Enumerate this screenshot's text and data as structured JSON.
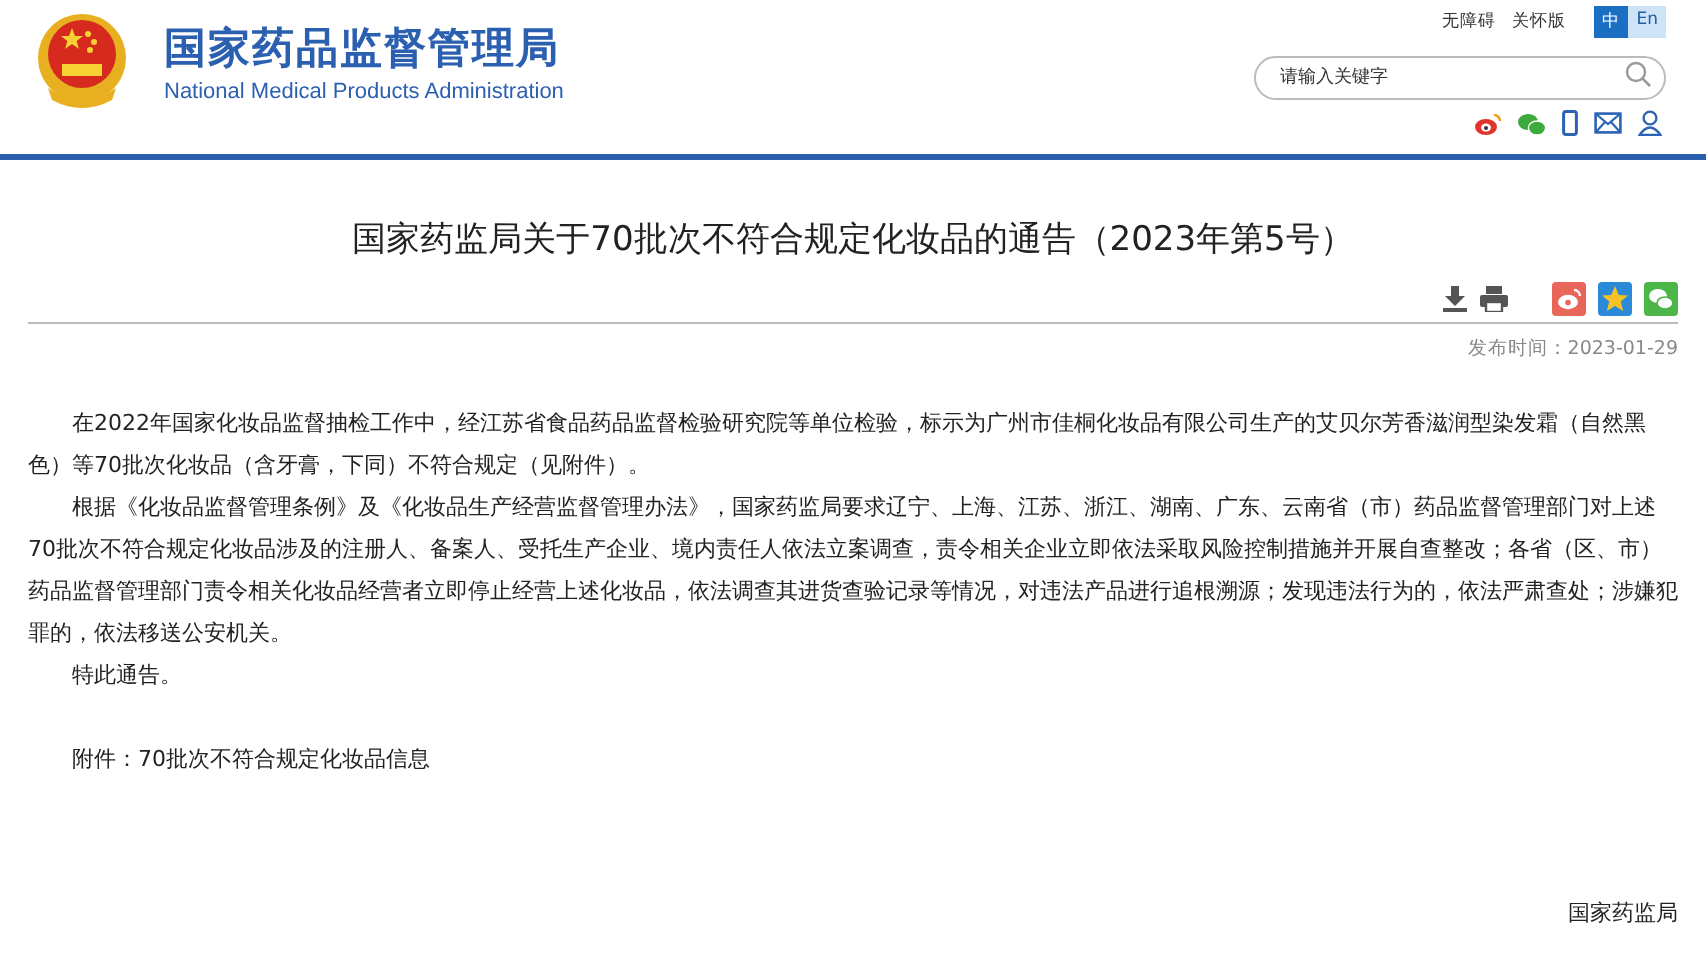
{
  "header": {
    "title_cn": "国家药品监督管理局",
    "title_en": "National Medical Products Administration",
    "links": [
      "无障碍",
      "关怀版"
    ],
    "languages": [
      {
        "label": "中",
        "selected": true
      },
      {
        "label": "En",
        "selected": false
      }
    ],
    "search": {
      "placeholder": "请输入关键字"
    }
  },
  "article": {
    "title": "国家药监局关于70批次不符合规定化妆品的通告（2023年第5号）",
    "date": "发布时间：2023-01-29",
    "paragraphs": [
      "在2022年国家化妆品监督抽检工作中，经江苏省食品药品监督检验研究院等单位检验，标示为广州市佳桐化妆品有限公司生产的艾贝尔芳香滋润型染发霜（自然黑色）等70批次化妆品（含牙膏，下同）不符合规定（见附件）。",
      "根据《化妆品监督管理条例》及《化妆品生产经营监督管理办法》，国家药监局要求辽宁、上海、江苏、浙江、湖南、广东、云南省（市）药品监督管理部门对上述70批次不符合规定化妆品涉及的注册人、备案人、受托生产企业、境内责任人依法立案调查，责令相关企业立即依法采取风险控制措施并开展自查整改；各省（区、市）药品监督管理部门责令相关化妆品经营者立即停止经营上述化妆品，依法调查其进货查验记录等情况，对违法产品进行追根溯源；发现违法行为的，依法严肃查处；涉嫌犯罪的，依法移送公安机关。",
      "特此通告。"
    ],
    "attachment": "附件：70批次不符合规定化妆品信息",
    "signature": "国家药监局"
  }
}
